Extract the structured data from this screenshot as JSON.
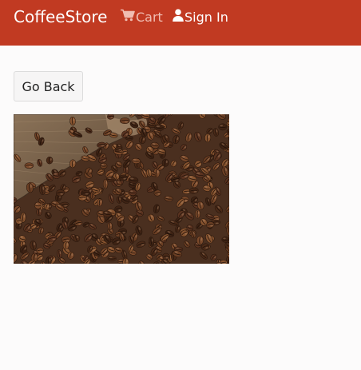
{
  "navbar": {
    "brand": "CoffeeStore",
    "cart_label": "Cart",
    "cart_icon": "shopping-cart-icon",
    "signin_label": "Sign In",
    "signin_icon": "user-icon",
    "background_color": "#c13a22"
  },
  "main": {
    "back_button_label": "Go Back",
    "image_subject": "coffee-beans-sack"
  }
}
